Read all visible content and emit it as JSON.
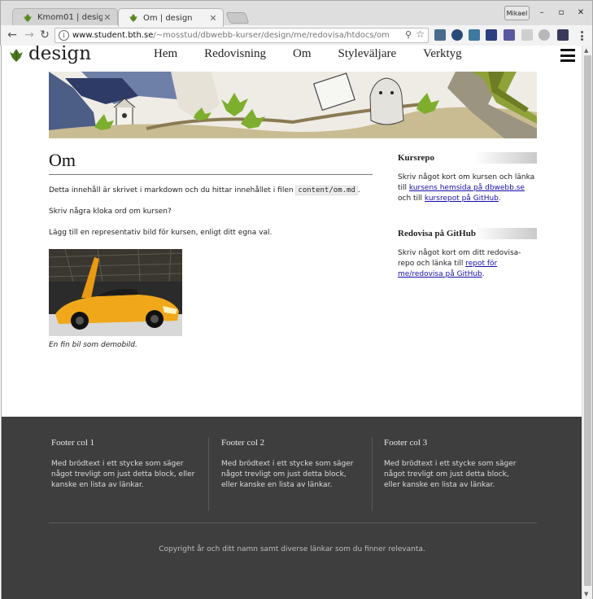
{
  "browser": {
    "tabs": [
      {
        "label": "Kmom01 | design",
        "active": false
      },
      {
        "label": "Om | design",
        "active": true
      }
    ],
    "profile_name": "Mikael",
    "url_host": "www.student.bth.se",
    "url_path": "/~mosstud/dbwebb-kurser/design/me/redovisa/htdocs/om",
    "icons": {
      "back": "back-arrow-icon",
      "forward": "forward-arrow-icon",
      "reload": "reload-icon",
      "info": "info-icon",
      "zoom": "zoom-icon",
      "bookmark": "star-icon",
      "menu": "kebab-menu-icon"
    }
  },
  "site": {
    "title": "design",
    "nav": [
      "Hem",
      "Redovisning",
      "Om",
      "Styleväljare",
      "Verktyg"
    ],
    "accent_green": "#4a7a1e"
  },
  "main": {
    "heading": "Om",
    "para1_prefix": "Detta innehåll är skrivet i markdown och du hittar innehållet i filen ",
    "para1_code": "content/om.md",
    "para1_suffix": ".",
    "para2": "Skriv några kloka ord om kursen?",
    "para3": "Lägg till en representativ bild för kursen, enligt ditt egna val.",
    "caption": "En fin bil som demobild."
  },
  "sidebar": {
    "kursrepo": {
      "title": "Kursrepo",
      "text1": "Skriv något kort om kursen och länka till ",
      "link1": "kursens hemsida på dbwebb.se",
      "text2": " och till ",
      "link2": "kursrepot på GitHub",
      "text3": "."
    },
    "github": {
      "title": "Redovisa på GitHub",
      "text1": "Skriv något kort om ditt redovisa-repo och länka till ",
      "link1": "repot för me/redovisa på GitHub",
      "text2": "."
    }
  },
  "footer": {
    "cols": [
      {
        "title": "Footer col 1",
        "text": "Med brödtext i ett stycke som säger något trevligt om just detta block, eller kanske en lista av länkar."
      },
      {
        "title": "Footer col 2",
        "text": "Med brödtext i ett stycke som säger något trevligt om just detta block, eller kanske en lista av länkar."
      },
      {
        "title": "Footer col 3",
        "text": "Med brödtext i ett stycke som säger något trevligt om just detta block, eller kanske en lista av länkar."
      }
    ],
    "copyright": "Copyright år och ditt namn samt diverse länkar som du finner relevanta."
  }
}
